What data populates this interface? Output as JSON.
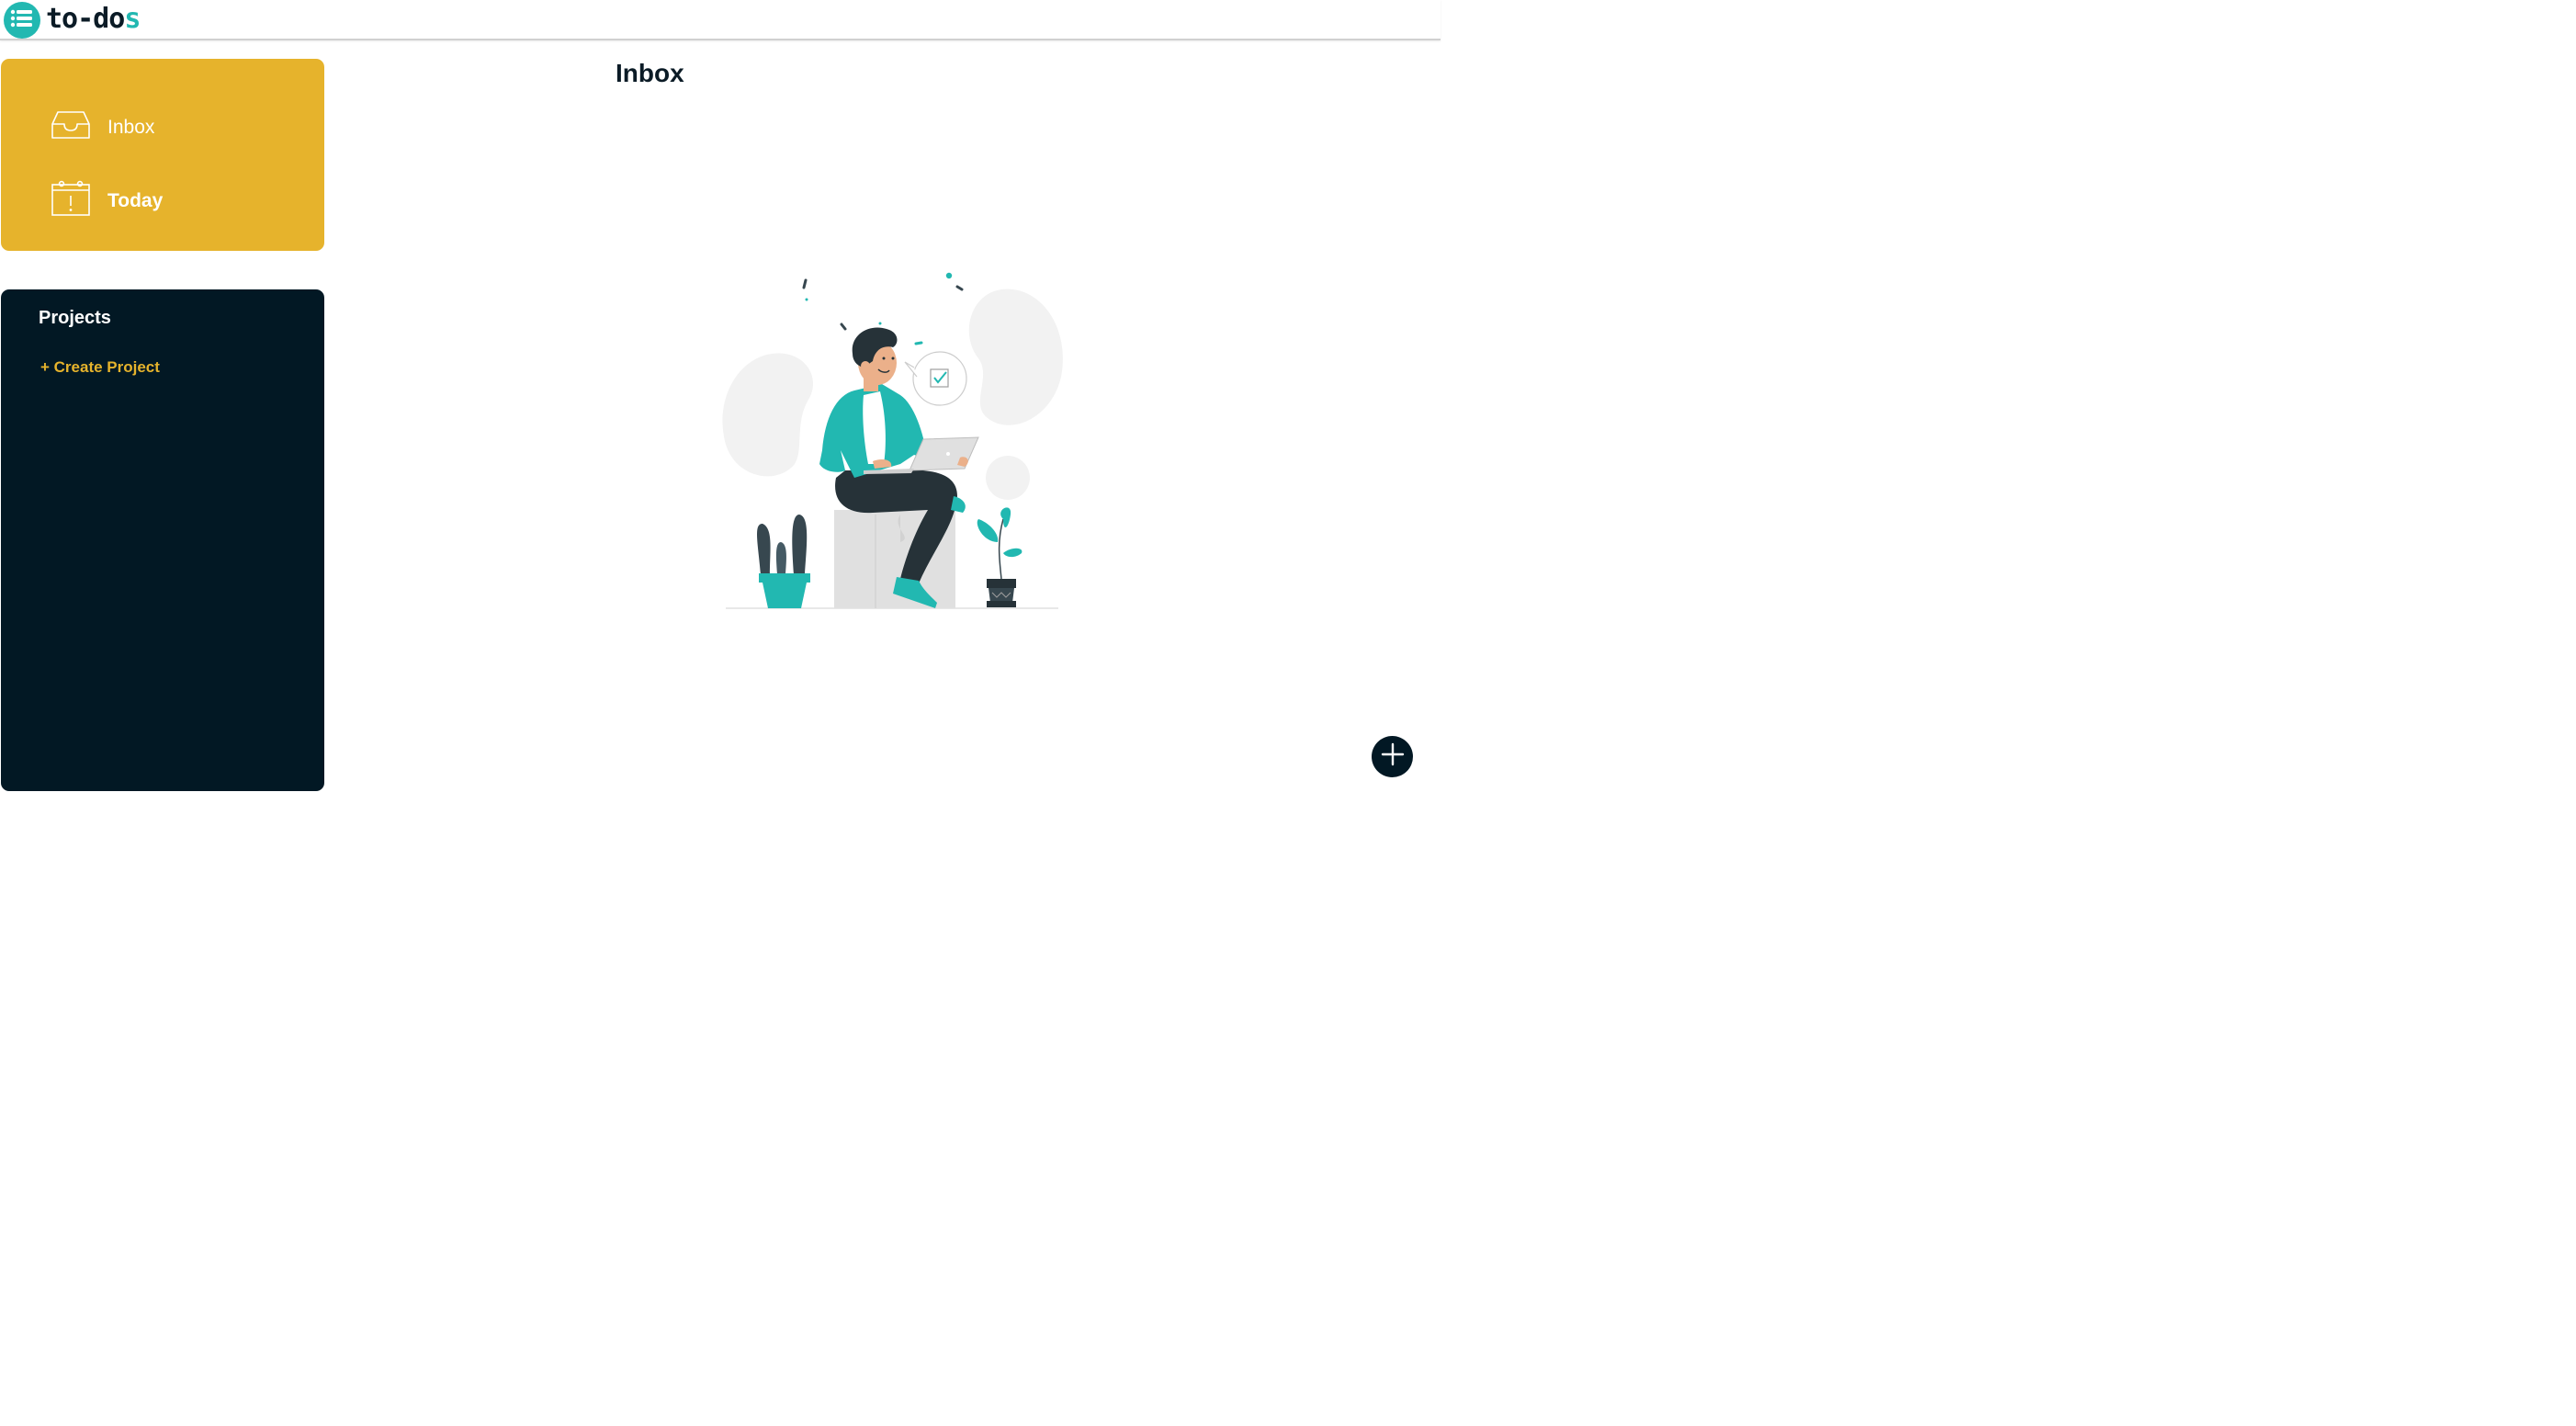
{
  "app": {
    "logo_main": "to-do",
    "logo_accent": "s"
  },
  "sidebar": {
    "items": [
      {
        "label": "Inbox",
        "icon": "inbox-tray-icon"
      },
      {
        "label": "Today",
        "icon": "calendar-alert-icon"
      }
    ],
    "projects_title": "Projects",
    "create_project_label": "+ Create Project"
  },
  "main": {
    "title": "Inbox",
    "empty_illustration": "person-with-laptop-illustration"
  },
  "fab": {
    "icon": "plus-icon"
  },
  "colors": {
    "accent_teal": "#22b8b1",
    "accent_yellow": "#e6b32c",
    "dark_navy": "#021824"
  }
}
